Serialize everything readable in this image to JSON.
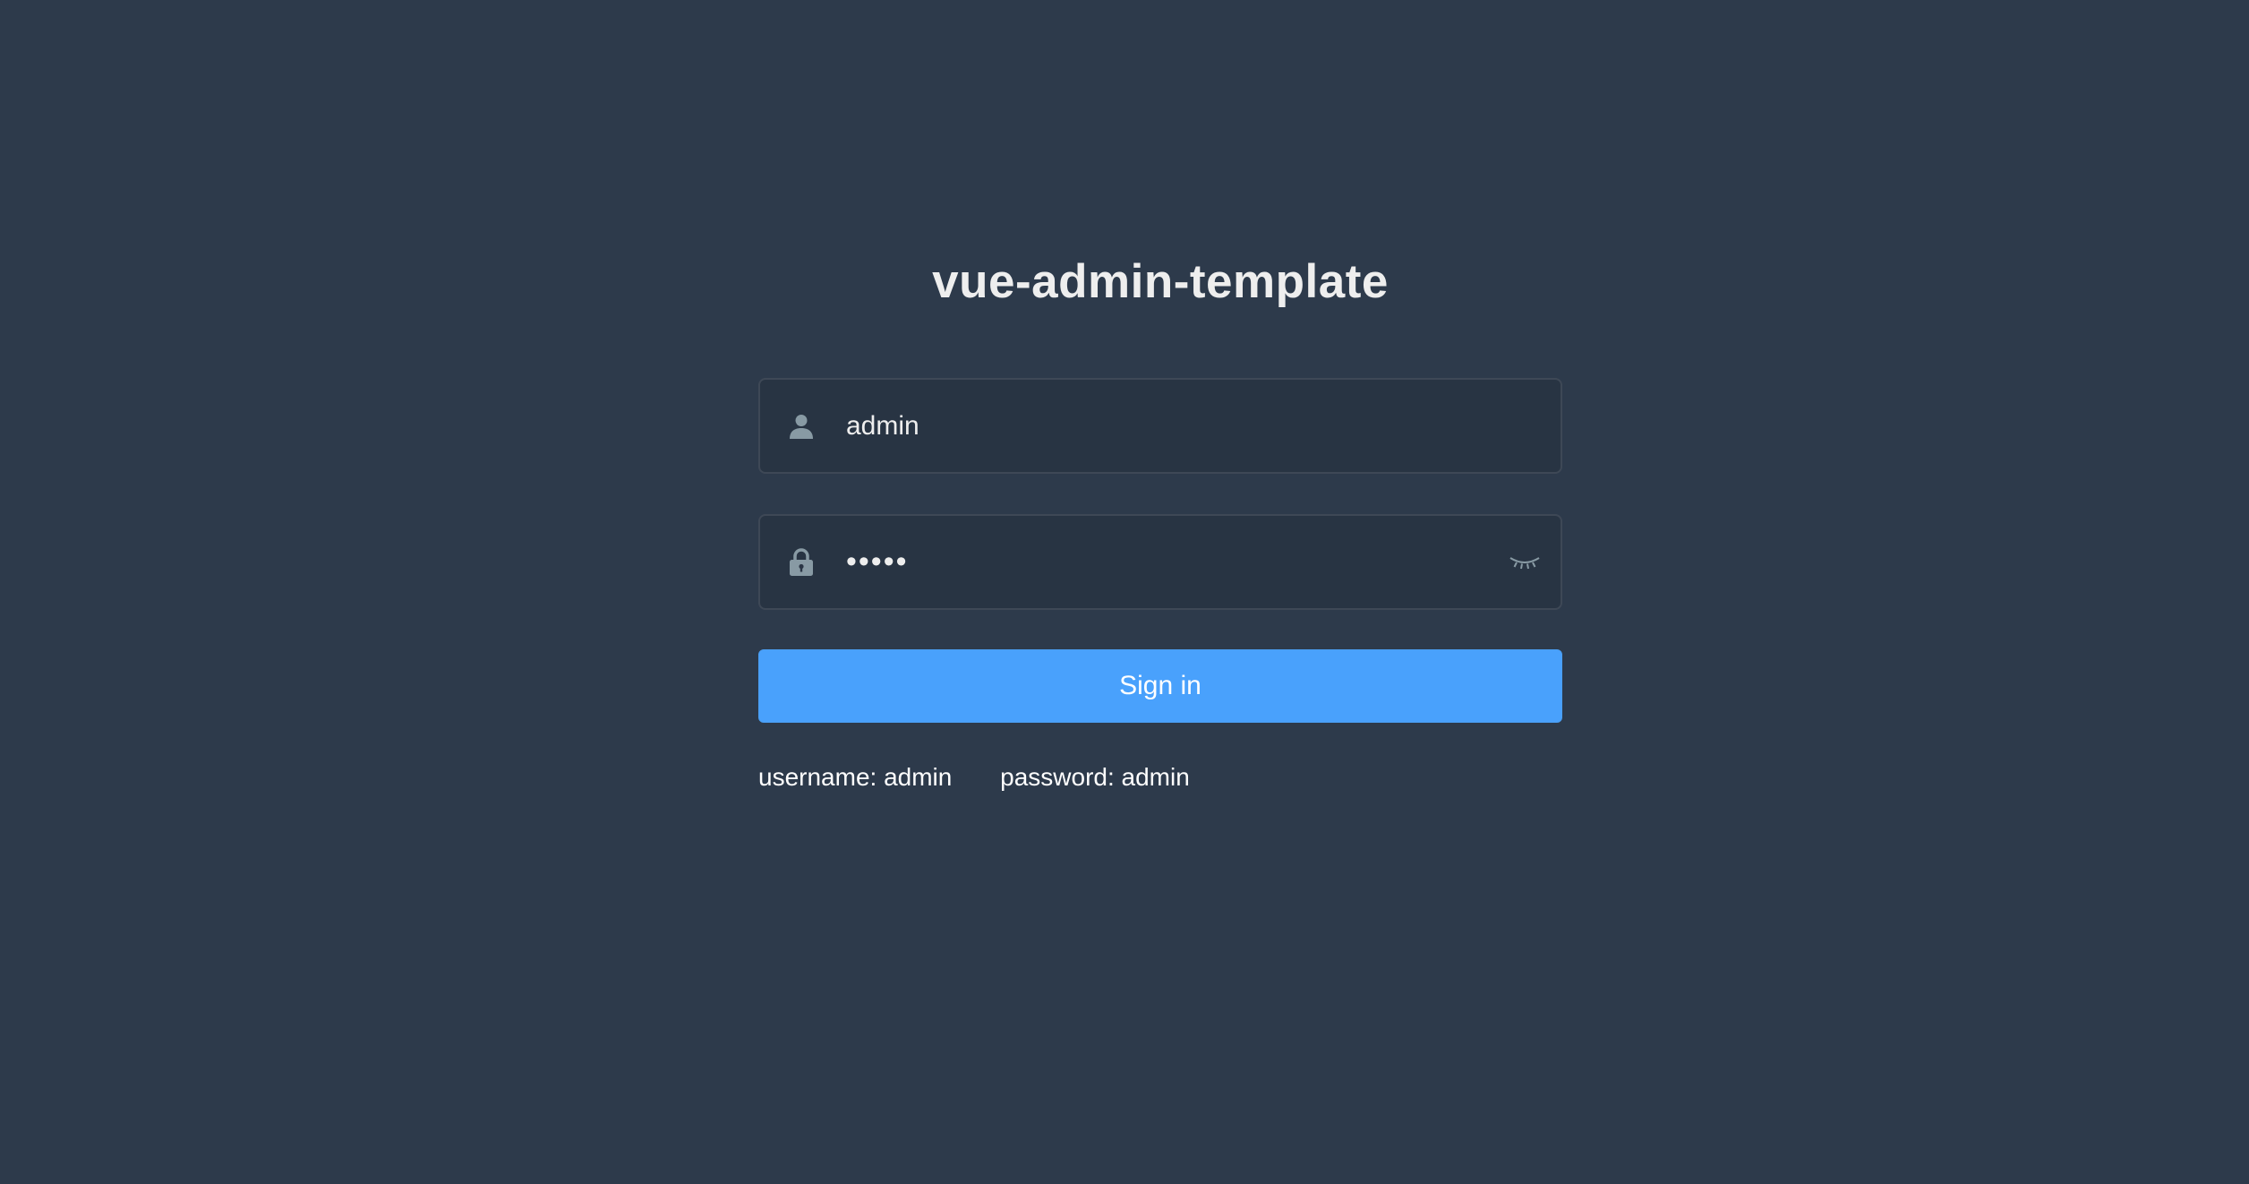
{
  "login": {
    "title": "vue-admin-template",
    "username_value": "admin",
    "password_value": "admin",
    "signin_label": "Sign in",
    "tip_username": "username: admin",
    "tip_password": "password: admin"
  },
  "icons": {
    "username_prefix": "user-icon",
    "password_prefix": "lock-icon",
    "password_toggle": "eye-closed-icon"
  },
  "colors": {
    "background": "#2d3a4b",
    "primary_button": "#49a1fc",
    "icon": "#889aa4",
    "text": "#eeeeee"
  }
}
